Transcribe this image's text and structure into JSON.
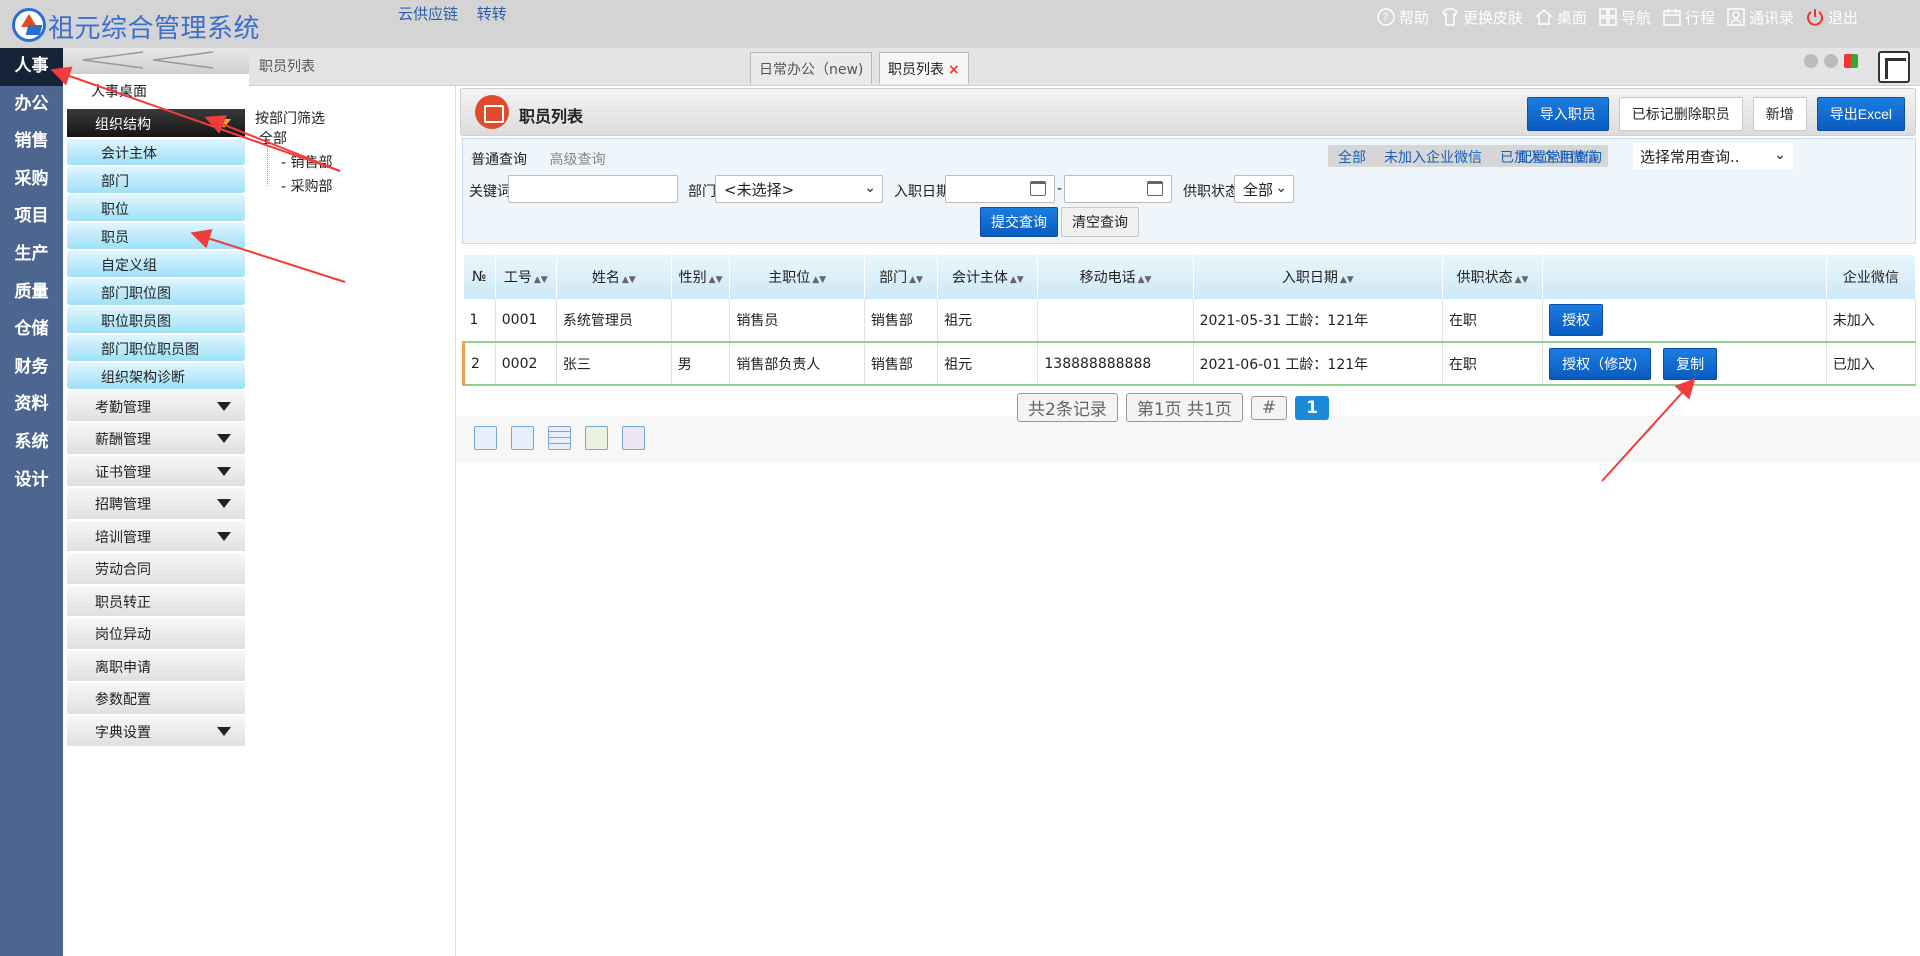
{
  "app": {
    "title": "祖元综合管理系统",
    "top_links": [
      "云供应链",
      "转转"
    ]
  },
  "top_menu": [
    {
      "icon": "help-icon",
      "label": "帮助"
    },
    {
      "icon": "skin-icon",
      "label": "更换皮肤"
    },
    {
      "icon": "home-icon",
      "label": "桌面"
    },
    {
      "icon": "nav-icon",
      "label": "导航"
    },
    {
      "icon": "calendar-icon",
      "label": "行程"
    },
    {
      "icon": "contacts-icon",
      "label": "通讯录"
    },
    {
      "icon": "power-icon",
      "label": "退出"
    }
  ],
  "left_nav": [
    "人事",
    "办公",
    "销售",
    "采购",
    "项目",
    "生产",
    "质量",
    "仓储",
    "财务",
    "资料",
    "系统",
    "设计"
  ],
  "sidebar": {
    "desk": "人事桌面",
    "org_group": "组织结构",
    "org_items": [
      "会计主体",
      "部门",
      "职位",
      "职员",
      "自定义组",
      "部门职位图",
      "职位职员图",
      "部门职位职员图",
      "组织架构诊断"
    ],
    "groups": [
      {
        "label": "考勤管理",
        "caret": true
      },
      {
        "label": "薪酬管理",
        "caret": true
      },
      {
        "label": "证书管理",
        "caret": true
      },
      {
        "label": "招聘管理",
        "caret": true
      },
      {
        "label": "培训管理",
        "caret": true
      },
      {
        "label": "劳动合同",
        "caret": false
      },
      {
        "label": "职员转正",
        "caret": false
      },
      {
        "label": "岗位异动",
        "caret": false
      },
      {
        "label": "离职申请",
        "caret": false
      },
      {
        "label": "参数配置",
        "caret": false
      },
      {
        "label": "字典设置",
        "caret": true
      }
    ]
  },
  "breadcrumb": "职员列表",
  "tabs": [
    {
      "label": "日常办公（new)"
    },
    {
      "label": "职员列表",
      "close": "×"
    }
  ],
  "filter": {
    "title": "按部门筛选",
    "root": "全部",
    "nodes": [
      "销售部",
      "采购部"
    ]
  },
  "header": {
    "title": "职员列表",
    "buttons": [
      {
        "label": "导入职员",
        "style": "blue"
      },
      {
        "label": "已标记删除职员",
        "style": "white"
      },
      {
        "label": "新增",
        "style": "white"
      },
      {
        "label": "导出Excel",
        "style": "blue"
      }
    ]
  },
  "search": {
    "tab_normal": "普通查询",
    "tab_advanced": "高级查询",
    "wechat_filters": [
      "全部",
      "未加入企业微信",
      "已加入企业微信"
    ],
    "config_link": "配置常用查询",
    "common_query": "选择常用查询..",
    "keyword_label": "关键词",
    "keyword_value": "",
    "dept_label": "部门",
    "dept_value": "<未选择>",
    "date_label": "入职日期",
    "date_sep": "-",
    "status_label": "供职状态",
    "status_value": "全部",
    "submit": "提交查询",
    "clear": "清空查询"
  },
  "table": {
    "columns": [
      "№",
      "工号",
      "姓名",
      "性别",
      "主职位",
      "部门",
      "会计主体",
      "移动电话",
      "入职日期",
      "供职状态",
      "",
      "企业微信"
    ],
    "sortable": [
      false,
      true,
      true,
      true,
      true,
      true,
      true,
      true,
      true,
      true,
      false,
      false
    ],
    "rows": [
      {
        "no": "1",
        "code": "0001",
        "name": "系统管理员",
        "gender": "",
        "position": "销售员",
        "dept": "销售部",
        "entity": "祖元",
        "phone": "",
        "hire": "2021-05-31 工龄：121年",
        "status": "在职",
        "actions": [
          "授权"
        ],
        "wechat": "未加入"
      },
      {
        "no": "2",
        "code": "0002",
        "name": "张三",
        "gender": "男",
        "position": "销售部负责人",
        "dept": "销售部",
        "entity": "祖元",
        "phone": "138888888888",
        "hire": "2021-06-01 工龄：121年",
        "status": "在职",
        "actions": [
          "授权（修改)",
          "复制"
        ],
        "wechat": "已加入"
      }
    ]
  },
  "pager": {
    "total": "共2条记录",
    "page": "第1页 共1页",
    "hash": "#",
    "current": "1"
  },
  "colors": {
    "left_nav": "#4d6690",
    "accent": "#0a5bc0",
    "arrow": "#f03c3c"
  }
}
